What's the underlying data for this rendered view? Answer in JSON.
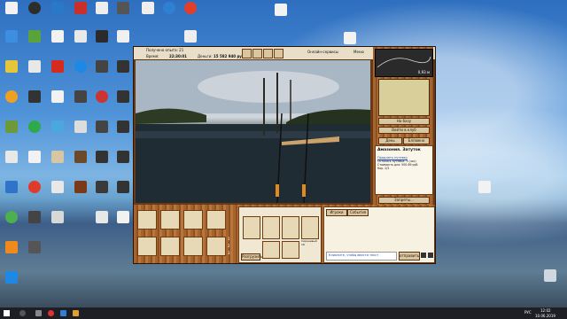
{
  "desktop_icons": [
    {
      "label": "",
      "color": "#2a7fd4"
    },
    {
      "label": "",
      "color": "#3a3a3a"
    },
    {
      "label": "",
      "color": "#e8e8e8"
    },
    {
      "label": "",
      "color": "#d64b2f"
    },
    {
      "label": "",
      "color": "#ffffff"
    },
    {
      "label": "",
      "color": "#4a4a4a"
    },
    {
      "label": "",
      "color": "#3c8dde"
    },
    {
      "label": "",
      "color": "#e84b2a"
    }
  ],
  "game": {
    "topbar": {
      "caught_label": "Получено опыта: 21",
      "time_label": "Время:",
      "time_value": "22:30:01",
      "money_label": "Деньги:",
      "money_value": "15 582 940 руб.",
      "services_label": "Онлайн-сервисы",
      "menu_label": "Меню"
    },
    "right": {
      "depth_value": "0,93 м",
      "base_button": "На базу",
      "clubs_button": "Войти в клуб",
      "tab_day": "День",
      "tab_reports": "Бл/звено",
      "location_title": "Амазония. Затуток",
      "info_link": "Продлить путевку",
      "info_line1": "Осталось путевки: 5 (час)",
      "info_line2": "Стоимость для: 500-69 руб.",
      "info_line3": "Кор. 2/2",
      "bans_button": "Запреты..."
    },
    "bottom": {
      "tab1": "Игроки",
      "tab2": "События",
      "gear_label": "Разгрузить",
      "chat_hint": "Кликните, чтобы ввести текст",
      "send_button": "отправить",
      "slot_numbers": [
        "1",
        "2",
        "3"
      ],
      "rod_label": "Сиреневый 1К"
    }
  },
  "taskbar": {
    "time": "12:02",
    "date": "10.06.2019",
    "lang": "РУС"
  }
}
